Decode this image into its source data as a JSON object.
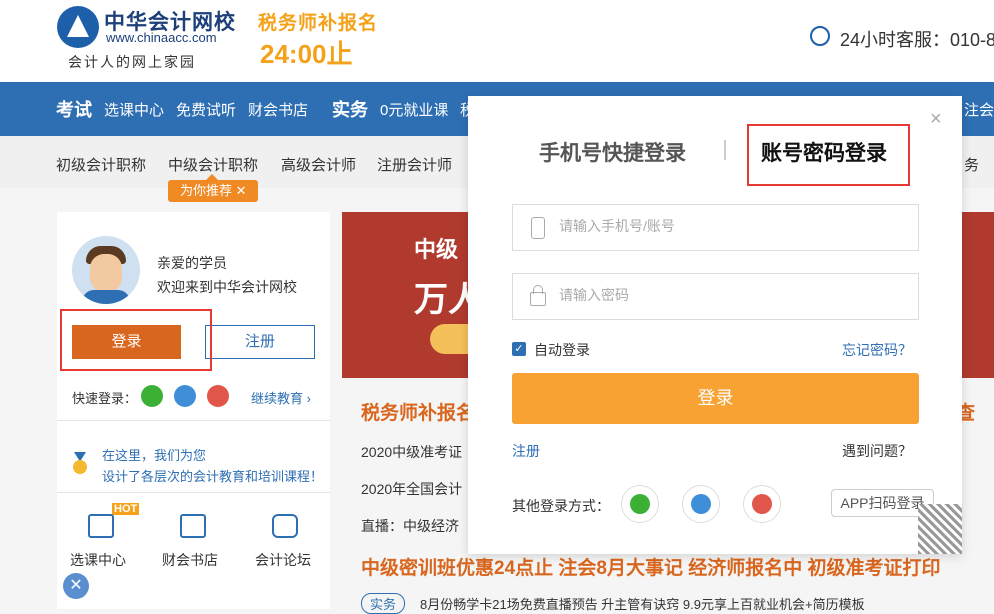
{
  "header": {
    "logo_name": "中华会计网校",
    "logo_url": "www.chinaacc.com",
    "slogan": "会计人的网上家园",
    "promo_line1": "税务师补报名",
    "promo_line2": "24:00止",
    "hotline": "24小时客服：010-8"
  },
  "blue_nav": {
    "exam": "考试",
    "items": [
      "选课中心",
      "免费试听",
      "财会书店"
    ],
    "practice": "实务",
    "practice_item": "0元就业课",
    "tail_left": "税",
    "tail_right": "注会"
  },
  "sub_nav": {
    "items": [
      "初级会计职称",
      "中级会计职称",
      "高级会计师",
      "注册会计师"
    ],
    "tail": "务",
    "recommend": "为你推荐"
  },
  "user_card": {
    "greeting1": "亲爱的学员",
    "greeting2": "欢迎来到中华会计网校",
    "login": "登录",
    "register": "注册",
    "quick_login": "快速登录：",
    "continue_edu": "继续教育",
    "info1": "在这里，我们为您",
    "info2": "设计了各层次的会计教育和培训课程！",
    "grid": [
      "选课中心",
      "财会书店",
      "会计论坛"
    ],
    "hot": "HOT"
  },
  "banner": {
    "tag": "中级",
    "big": "万人"
  },
  "news": {
    "headline": "税务师补报名",
    "headline_tail": "查",
    "lines": [
      "2020中级准考证",
      "2020年全国会计",
      "直播：中级经济"
    ],
    "big_line": "中级密训班优惠24点止  注会8月大事记  经济师报名中  初级准考证打印",
    "bottom_tag": "实务",
    "bottom_text": "8月份畅学卡21场免费直播预告  升主管有诀窍  9.9元享上百就业机会+简历模板"
  },
  "login_modal": {
    "close": "×",
    "tab_phone": "手机号快捷登录",
    "tab_account": "账号密码登录",
    "username_placeholder": "请输入手机号/账号",
    "password_placeholder": "请输入密码",
    "auto_login": "自动登录",
    "forgot": "忘记密码？",
    "login_button": "登录",
    "register": "注册",
    "problem": "遇到问题？",
    "other_methods": "其他登录方式：",
    "app_scan": "APP扫码登录"
  },
  "colors": {
    "brand_blue": "#2e6fb4",
    "orange": "#f7a232",
    "highlight_red": "#e53935"
  }
}
